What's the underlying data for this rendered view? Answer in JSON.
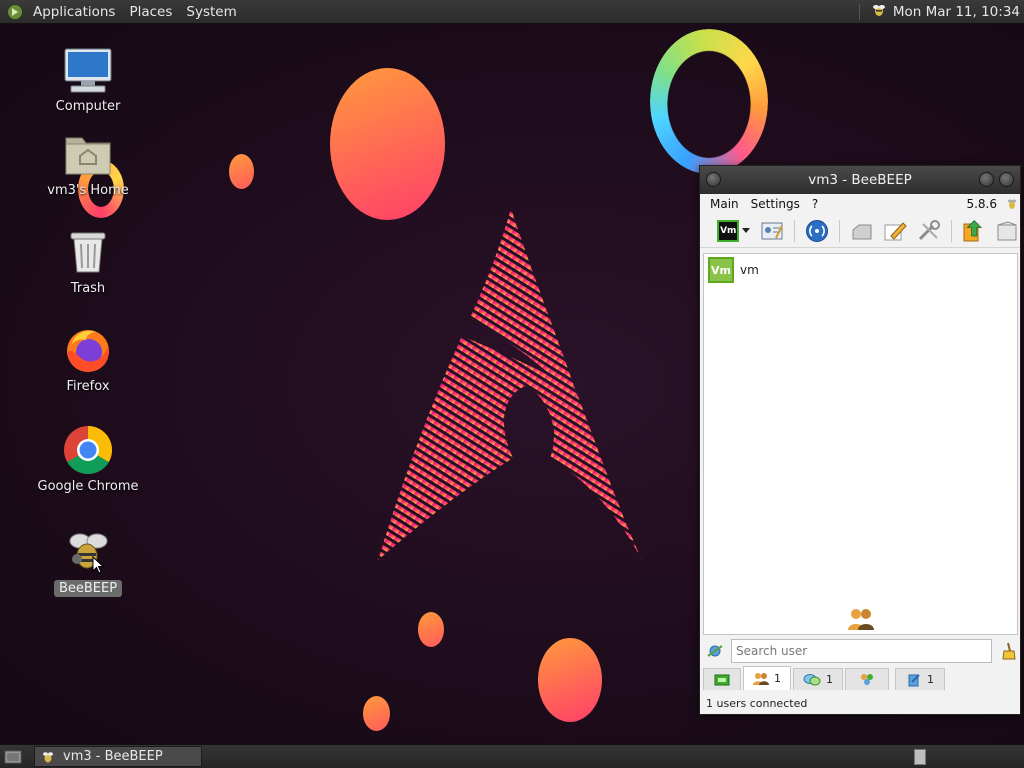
{
  "top_panel": {
    "menus": [
      "Applications",
      "Places",
      "System"
    ],
    "clock": "Mon Mar 11, 10:34"
  },
  "desktop": {
    "icons": [
      {
        "label": "Computer",
        "icon": "computer-icon"
      },
      {
        "label": "vm3's Home",
        "icon": "home-folder-icon"
      },
      {
        "label": "Trash",
        "icon": "trash-icon"
      },
      {
        "label": "Firefox",
        "icon": "firefox-icon"
      },
      {
        "label": "Google Chrome",
        "icon": "chrome-icon"
      },
      {
        "label": "BeeBEEP",
        "icon": "beebeep-icon",
        "selected": true
      }
    ]
  },
  "window": {
    "title": "vm3 - BeeBEEP",
    "menu": [
      "Main",
      "Settings",
      "?"
    ],
    "version": "5.8.6",
    "users": [
      {
        "badge": "Vm",
        "name": "vm"
      }
    ],
    "search_placeholder": "Search user",
    "tabs": [
      {
        "icon": "network-icon",
        "count": ""
      },
      {
        "icon": "users-icon",
        "count": "1"
      },
      {
        "icon": "chat-icon",
        "count": "1"
      },
      {
        "icon": "groups-icon",
        "count": ""
      },
      {
        "icon": "files-icon",
        "count": "1"
      }
    ],
    "status": "1 users connected"
  },
  "taskbar": {
    "task": "vm3 - BeeBEEP"
  },
  "colors": {
    "accent_green": "#8bc34a",
    "wallpaper": "#1e0f1c",
    "arch_pink": "#e9246f"
  }
}
